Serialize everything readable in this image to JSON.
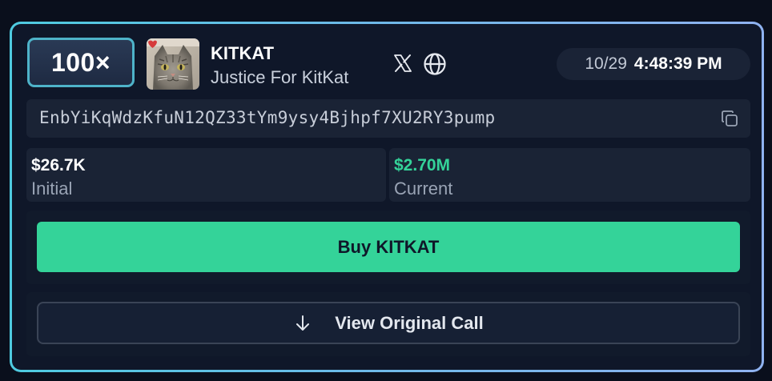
{
  "multiplier": "100×",
  "token": {
    "name": "KITKAT",
    "description": "Justice For KitKat",
    "avatar_icon": "cat-photo-avatar"
  },
  "links": {
    "x_icon": "x-logo-icon",
    "website_icon": "globe-icon"
  },
  "time": {
    "date": "10/29",
    "clock": "4:48:39 PM"
  },
  "address": {
    "value": "EnbYiKqWdzKfuN12QZ33tYm9ysy4Bjhpf7XU2RY3pump",
    "copy_icon": "copy-icon"
  },
  "stats": {
    "initial": {
      "value": "$26.7K",
      "label": "Initial"
    },
    "current": {
      "value": "$2.70M",
      "label": "Current"
    }
  },
  "actions": {
    "buy_label": "Buy KITKAT",
    "view_label": "View Original Call",
    "view_icon": "arrow-down-icon"
  },
  "colors": {
    "accent_green": "#34d399",
    "border_gradient_start": "#4ecbe0",
    "border_gradient_end": "#8fb2f0",
    "card_background": "#0f1729"
  }
}
